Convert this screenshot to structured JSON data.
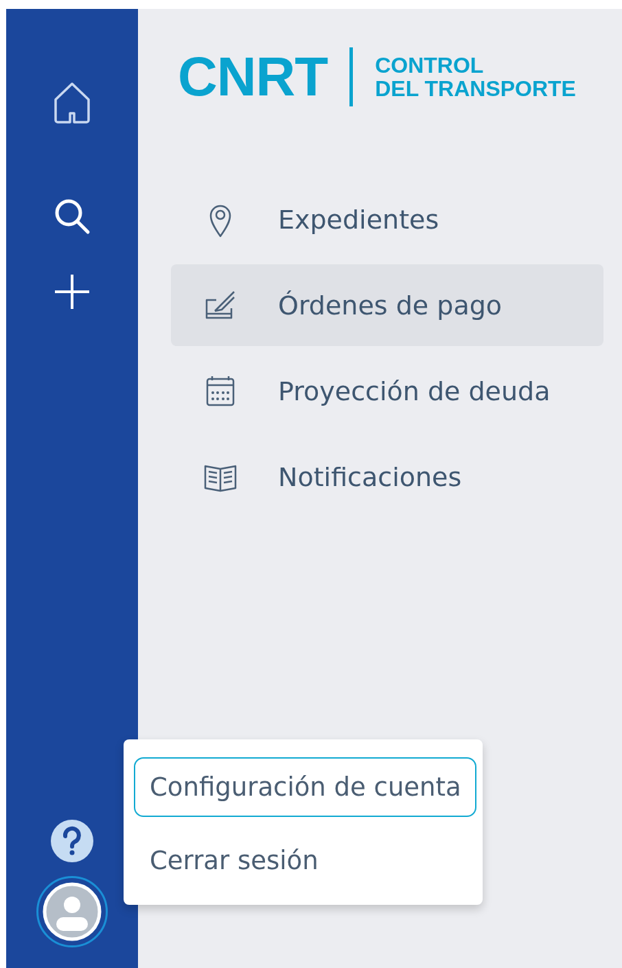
{
  "logo": {
    "acronym": "CNRT",
    "tagline": [
      "CONTROL",
      "DEL TRANSPORTE"
    ]
  },
  "nav": [
    {
      "kind": "pin",
      "label": "Expedientes",
      "selected": false
    },
    {
      "kind": "edit",
      "label": "Órdenes de pago",
      "selected": true
    },
    {
      "kind": "calendar",
      "label": "Proyección de deuda",
      "selected": false
    },
    {
      "kind": "book",
      "label": "Notificaciones",
      "selected": false
    }
  ],
  "user_menu": [
    {
      "label": "Configuración de cuenta",
      "selected": true
    },
    {
      "label": "Cerrar sesión",
      "selected": false
    }
  ]
}
